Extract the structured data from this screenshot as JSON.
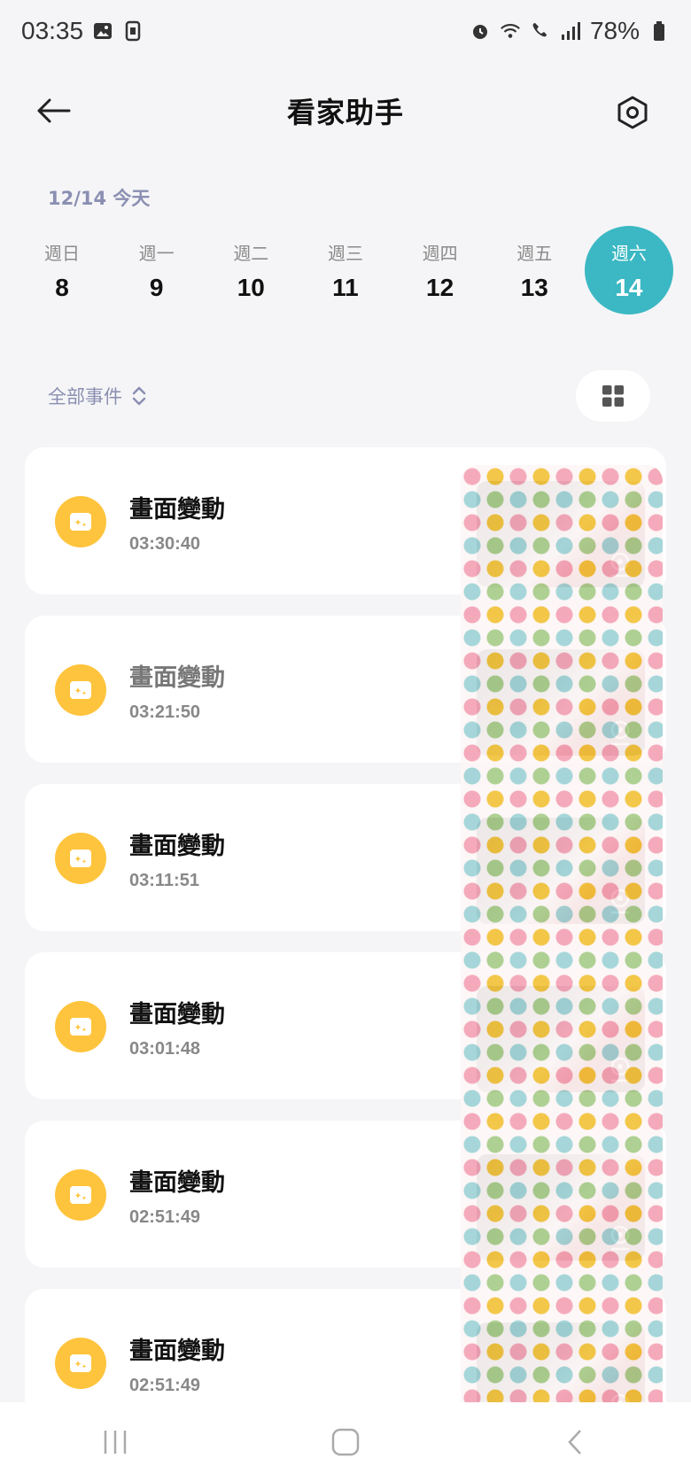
{
  "status": {
    "time": "03:35",
    "battery": "78%"
  },
  "header": {
    "title": "看家助手"
  },
  "date_label": "12/14 今天",
  "week": [
    {
      "name": "週日",
      "num": "8",
      "active": false
    },
    {
      "name": "週一",
      "num": "9",
      "active": false
    },
    {
      "name": "週二",
      "num": "10",
      "active": false
    },
    {
      "name": "週三",
      "num": "11",
      "active": false
    },
    {
      "name": "週四",
      "num": "12",
      "active": false
    },
    {
      "name": "週五",
      "num": "13",
      "active": false
    },
    {
      "name": "週六",
      "num": "14",
      "active": true
    }
  ],
  "filter": {
    "label": "全部事件"
  },
  "events": [
    {
      "title": "畫面變動",
      "time": "03:30:40"
    },
    {
      "title": "畫面變動",
      "time": "03:21:50"
    },
    {
      "title": "畫面變動",
      "time": "03:11:51"
    },
    {
      "title": "畫面變動",
      "time": "03:01:48"
    },
    {
      "title": "畫面變動",
      "time": "02:51:49"
    },
    {
      "title": "畫面變動",
      "time": "02:51:49"
    }
  ],
  "colors": {
    "accent": "#3bb8c3",
    "event_icon": "#ffc43d",
    "muted_label": "#8a8fb2"
  }
}
